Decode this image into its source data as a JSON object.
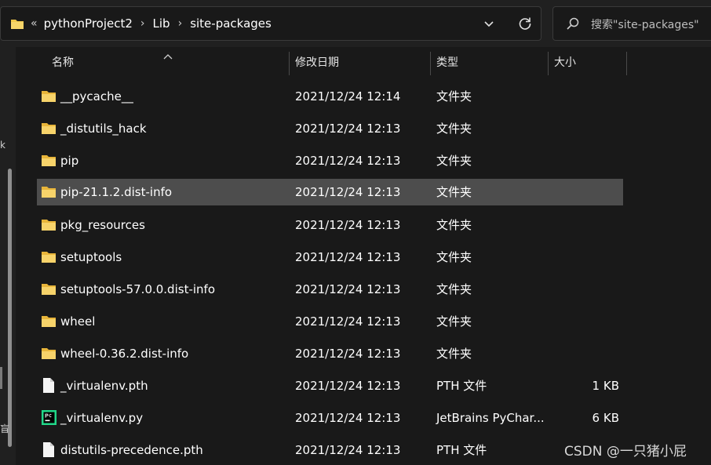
{
  "address_bar": {
    "overflow": "«",
    "breadcrumbs": [
      "pythonProject2",
      "Lib",
      "site-packages"
    ]
  },
  "search": {
    "placeholder": "搜索\"site-packages\""
  },
  "columns": {
    "name": "名称",
    "date": "修改日期",
    "type": "类型",
    "size": "大小"
  },
  "rows": [
    {
      "name": "__pycache__",
      "date": "2021/12/24 12:14",
      "type": "文件夹",
      "size": "",
      "icon": "folder-icon"
    },
    {
      "name": "_distutils_hack",
      "date": "2021/12/24 12:13",
      "type": "文件夹",
      "size": "",
      "icon": "folder-icon"
    },
    {
      "name": "pip",
      "date": "2021/12/24 12:13",
      "type": "文件夹",
      "size": "",
      "icon": "folder-icon"
    },
    {
      "name": "pip-21.1.2.dist-info",
      "date": "2021/12/24 12:13",
      "type": "文件夹",
      "size": "",
      "icon": "folder-icon",
      "selected": true
    },
    {
      "name": "pkg_resources",
      "date": "2021/12/24 12:13",
      "type": "文件夹",
      "size": "",
      "icon": "folder-icon"
    },
    {
      "name": "setuptools",
      "date": "2021/12/24 12:13",
      "type": "文件夹",
      "size": "",
      "icon": "folder-icon"
    },
    {
      "name": "setuptools-57.0.0.dist-info",
      "date": "2021/12/24 12:13",
      "type": "文件夹",
      "size": "",
      "icon": "folder-icon"
    },
    {
      "name": "wheel",
      "date": "2021/12/24 12:13",
      "type": "文件夹",
      "size": "",
      "icon": "folder-icon"
    },
    {
      "name": "wheel-0.36.2.dist-info",
      "date": "2021/12/24 12:13",
      "type": "文件夹",
      "size": "",
      "icon": "folder-icon"
    },
    {
      "name": "_virtualenv.pth",
      "date": "2021/12/24 12:13",
      "type": "PTH 文件",
      "size": "1 KB",
      "icon": "file-icon"
    },
    {
      "name": "_virtualenv.py",
      "date": "2021/12/24 12:13",
      "type": "JetBrains PyChar...",
      "size": "6 KB",
      "icon": "pycharm-file-icon"
    },
    {
      "name": "distutils-precedence.pth",
      "date": "2021/12/24 12:13",
      "type": "PTH 文件",
      "size": "",
      "icon": "file-icon"
    }
  ],
  "nav_edge": {
    "glyph_top": "k",
    "glyph_bottom": "盲"
  },
  "watermark": "CSDN @一只猪小屁",
  "colors": {
    "background": "#191919",
    "toolbar": "#202020",
    "selected_row": "#4d4d4d",
    "folder": "#f2c84b"
  }
}
